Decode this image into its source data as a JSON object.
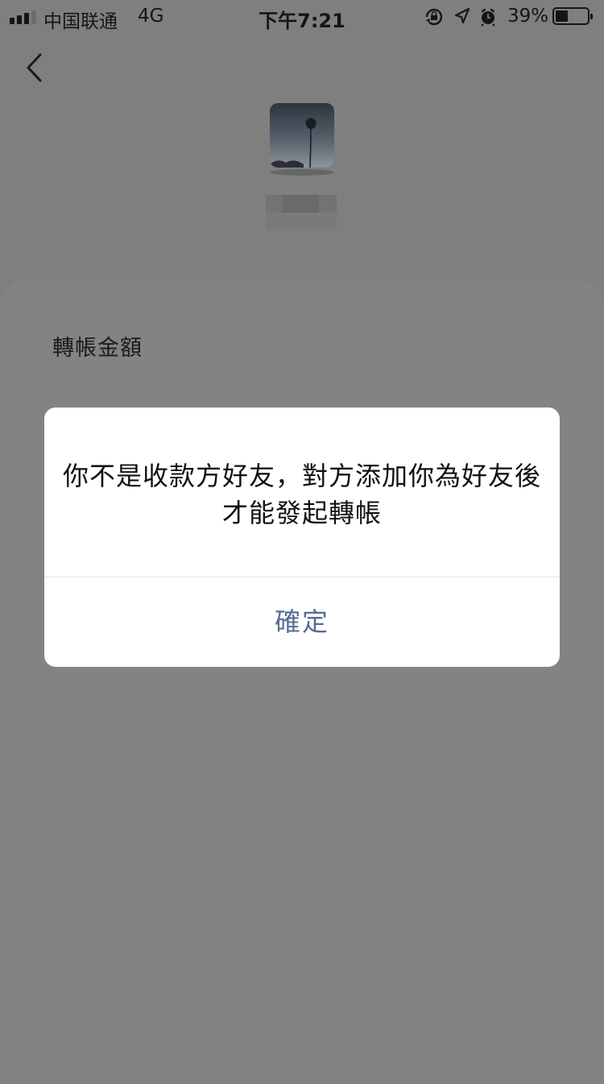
{
  "status_bar": {
    "carrier": "中国联通",
    "network": "4G",
    "time": "下午7:21",
    "battery_percent": "39%",
    "battery_level": 0.39,
    "icons": [
      "orientation-lock-icon",
      "location-arrow-icon",
      "alarm-icon"
    ]
  },
  "header": {
    "back_icon": "chevron-left-icon"
  },
  "recipient": {
    "avatar": "tulip-silhouette-avatar"
  },
  "form": {
    "amount_label": "轉帳金額"
  },
  "dialog": {
    "message": "你不是收款方好友，對方添加你為好友後才能發起轉帳",
    "confirm_label": "確定",
    "confirm_color": "#576b95"
  }
}
